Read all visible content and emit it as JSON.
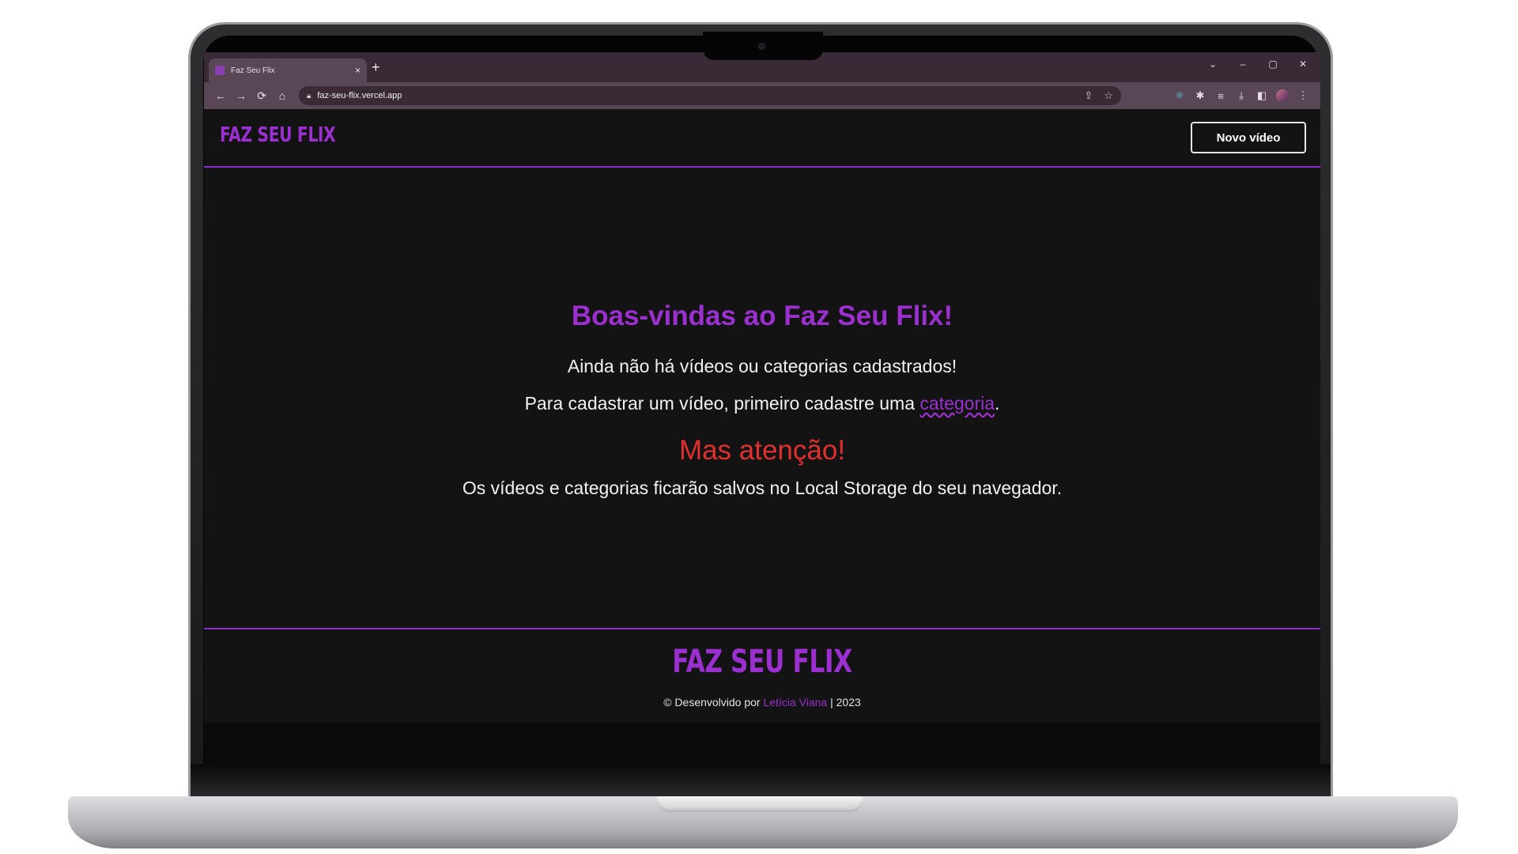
{
  "browser": {
    "tab_title": "Faz Seu Flix",
    "tab_close": "×",
    "new_tab": "+",
    "url": "faz-seu-flix.vercel.app",
    "window_controls": [
      "⌄",
      "–",
      "▢",
      "✕"
    ]
  },
  "header": {
    "logo": "FAZ SEU FLIX",
    "new_video_button": "Novo vídeo"
  },
  "main": {
    "welcome_title": "Boas-vindas ao Faz Seu Flix!",
    "no_content_text": "Ainda não há vídeos ou categorias cadastrados!",
    "instruction_prefix": "Para cadastrar um vídeo, primeiro cadastre uma ",
    "category_link": "categoria",
    "instruction_suffix": ".",
    "warning_title": "Mas atenção!",
    "storage_note": "Os vídeos e categorias ficarão salvos no Local Storage do seu navegador."
  },
  "footer": {
    "logo": "FAZ SEU FLIX",
    "credits_prefix": "© Desenvolvido por ",
    "author": "Letícia Viana",
    "credits_suffix": " | 2023"
  },
  "colors": {
    "accent": "#9b2fd0",
    "warning": "#e0302e",
    "background": "#131314",
    "browser_frame": "#5a4756"
  },
  "icons": [
    "back-arrow-icon",
    "forward-arrow-icon",
    "reload-icon",
    "home-icon",
    "lock-icon",
    "share-icon",
    "star-icon",
    "react-devtools-icon",
    "extensions-icon",
    "media-icon",
    "download-icon",
    "sidepanel-icon",
    "profile-avatar",
    "menu-dots-icon"
  ]
}
